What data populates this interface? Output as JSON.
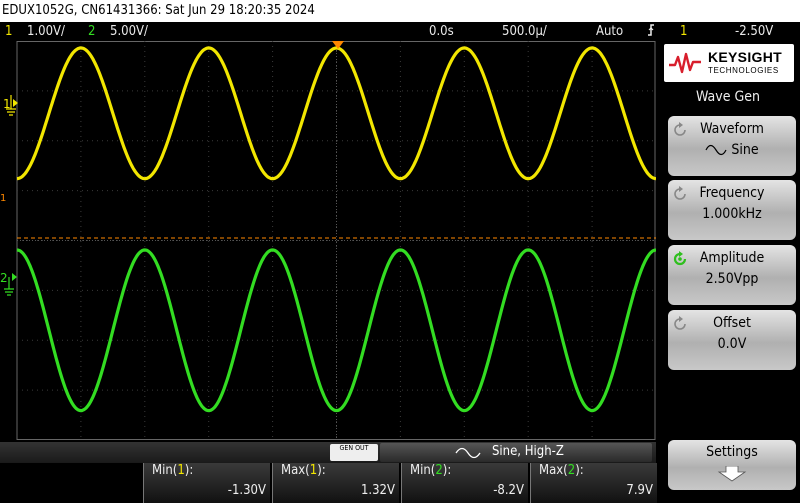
{
  "title": "EDUX1052G, CN61431366: Sat Jun 29 18:20:35 2024",
  "status": {
    "ch1_num": "1",
    "ch1_scale": "1.00V/",
    "ch2_num": "2",
    "ch2_scale": "5.00V/",
    "time_delay": "0.0s",
    "time_scale": "500.0µ/",
    "trigger_mode": "Auto",
    "trigger_source": "1",
    "trigger_level": "-2.50V"
  },
  "channel_markers": {
    "ch1": "1",
    "ch2": "2"
  },
  "colors": {
    "ch1": "#f2e600",
    "ch2": "#33dd22",
    "trigger": "#ff8800"
  },
  "trigger_line_level_v": -2.5,
  "waveforms": {
    "ch1": {
      "frequency_khz": 1.0,
      "peak_v": 1.31,
      "offset_div": 2.55,
      "volts_per_div": 1.0
    },
    "ch2": {
      "frequency_khz": 1.0,
      "peak_v": 8.05,
      "offset_div": -1.8,
      "volts_per_div": 5.0
    }
  },
  "brand": {
    "name": "KEYSIGHT",
    "sub": "TECHNOLOGIES",
    "icon": "keysight-logo-icon"
  },
  "menu": {
    "title": "Wave Gen",
    "waveform_label": "Waveform",
    "waveform_value": "Sine",
    "frequency_label": "Frequency",
    "frequency_value": "1.000kHz",
    "amplitude_label": "Amplitude",
    "amplitude_value": "2.50Vpp",
    "offset_label": "Offset",
    "offset_value": "0.0V",
    "settings_label": "Settings"
  },
  "gen_out": {
    "badge": "GEN OUT",
    "text": "Sine, High-Z"
  },
  "measurements": [
    {
      "name_prefix": "Min(",
      "channel": "1",
      "suffix": "):",
      "value": "-1.30V"
    },
    {
      "name_prefix": "Max(",
      "channel": "1",
      "suffix": "):",
      "value": "1.32V"
    },
    {
      "name_prefix": "Min(",
      "channel": "2",
      "suffix": "):",
      "value": "-8.2V"
    },
    {
      "name_prefix": "Max(",
      "channel": "2",
      "suffix": "):",
      "value": "7.9V"
    }
  ]
}
